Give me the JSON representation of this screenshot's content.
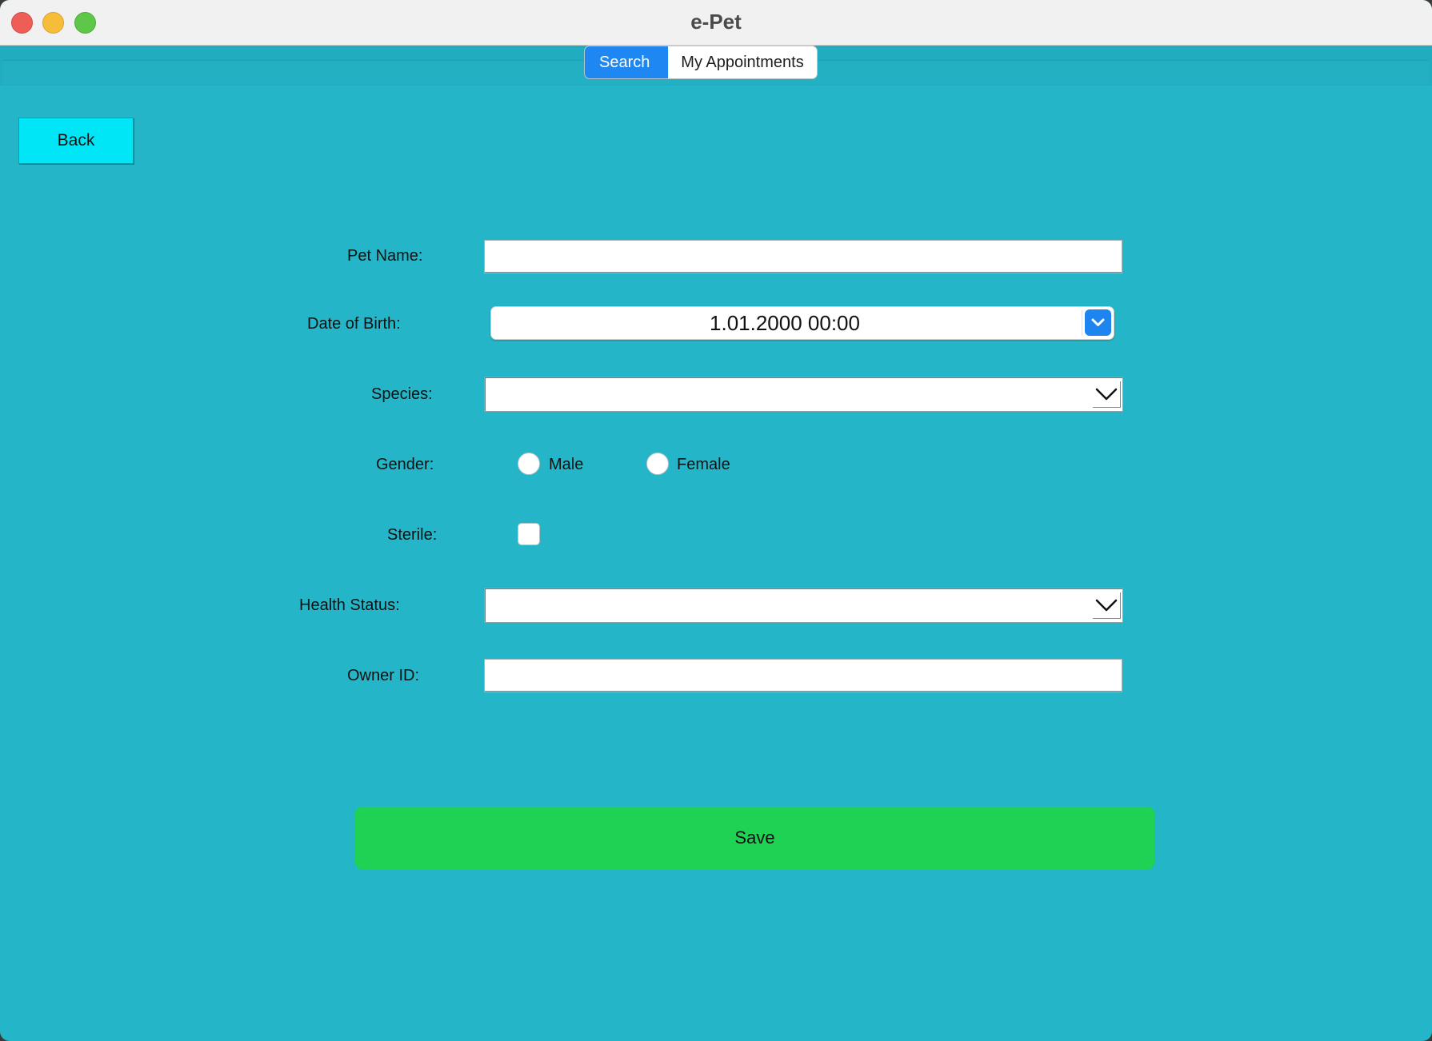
{
  "window": {
    "title": "e-Pet"
  },
  "tabs": [
    {
      "label": "Search",
      "active": true
    },
    {
      "label": "My Appointments",
      "active": false
    }
  ],
  "back_button": {
    "label": "Back"
  },
  "form": {
    "pet_name": {
      "label": "Pet Name:",
      "value": ""
    },
    "date_of_birth": {
      "label": "Date of Birth:",
      "value": "1.01.2000 00:00"
    },
    "species": {
      "label": "Species:",
      "selected": ""
    },
    "gender": {
      "label": "Gender:",
      "options": [
        "Male",
        "Female"
      ],
      "selected": null
    },
    "sterile": {
      "label": "Sterile:",
      "checked": false
    },
    "health_status": {
      "label": "Health Status:",
      "selected": ""
    },
    "owner_id": {
      "label": "Owner ID:",
      "value": ""
    }
  },
  "save_button": {
    "label": "Save"
  },
  "colors": {
    "background": "#24b6c8",
    "tab_active": "#1f87f2",
    "back_button": "#00e6f7",
    "save_button": "#1fd253"
  }
}
